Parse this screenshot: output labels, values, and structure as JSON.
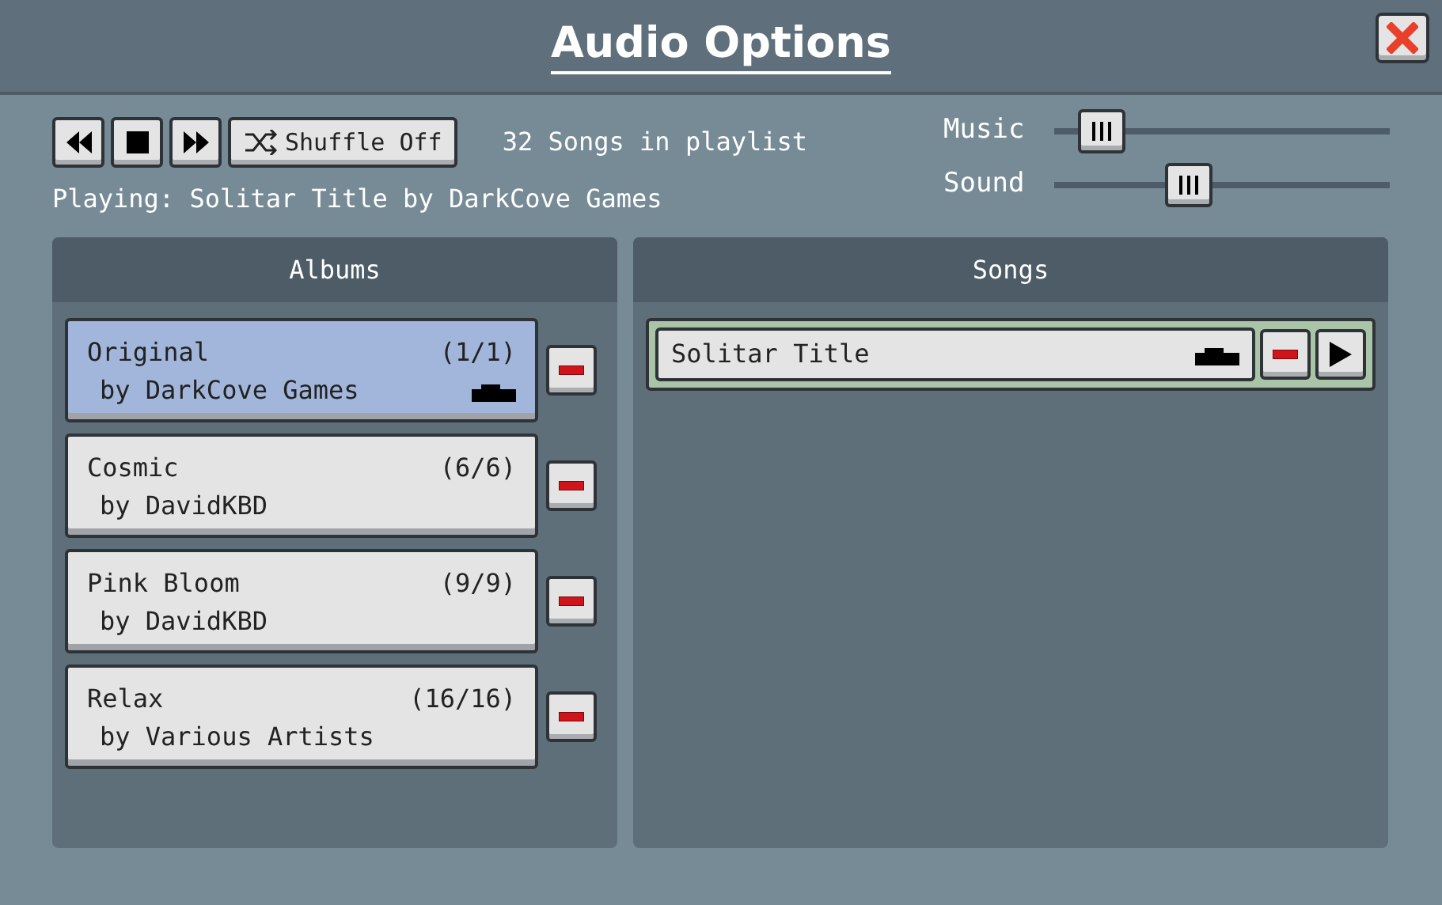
{
  "window": {
    "title": "Audio Options"
  },
  "controls": {
    "shuffle_label": "Shuffle Off",
    "song_count": "32 Songs in playlist",
    "now_playing": "Playing: Solitar Title by DarkCove Games"
  },
  "volumes": [
    {
      "label": "Music",
      "level": 0.14
    },
    {
      "label": "Sound",
      "level": 0.4
    }
  ],
  "albums": {
    "title": "Albums",
    "items": [
      {
        "name": "Original",
        "artist": "by DarkCove Games",
        "count": "(1/1)",
        "selected": true,
        "playing": true
      },
      {
        "name": "Cosmic",
        "artist": "by DavidKBD",
        "count": "(6/6)",
        "selected": false,
        "playing": false
      },
      {
        "name": "Pink Bloom",
        "artist": "by DavidKBD",
        "count": "(9/9)",
        "selected": false,
        "playing": false
      },
      {
        "name": "Relax",
        "artist": "by Various Artists",
        "count": "(16/16)",
        "selected": false,
        "playing": false
      }
    ]
  },
  "songs": {
    "title": "Songs",
    "items": [
      {
        "name": "Solitar Title",
        "playing": true
      }
    ]
  }
}
